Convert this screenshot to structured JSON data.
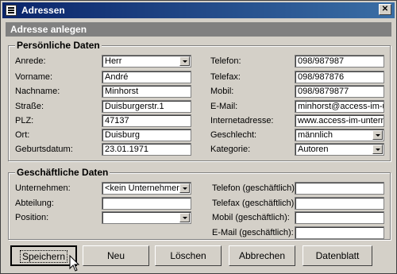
{
  "window": {
    "title": "Adressen",
    "close_label": "✕",
    "minimize_label": "_",
    "maximize_label": "□"
  },
  "header": {
    "title": "Adresse anlegen"
  },
  "personal": {
    "title": "Persönliche Daten",
    "anrede": {
      "label": "Anrede:",
      "value": "Herr"
    },
    "vorname": {
      "label": "Vorname:",
      "value": "André"
    },
    "nachname": {
      "label": "Nachname:",
      "value": "Minhorst"
    },
    "strasse": {
      "label": "Straße:",
      "value": "Duisburgerstr.1"
    },
    "plz": {
      "label": "PLZ:",
      "value": "47137"
    },
    "ort": {
      "label": "Ort:",
      "value": "Duisburg"
    },
    "geburtsdatum": {
      "label": "Geburtsdatum:",
      "value": "23.01.1971"
    },
    "telefon": {
      "label": "Telefon:",
      "value": "098/987987"
    },
    "telefax": {
      "label": "Telefax:",
      "value": "098/987876"
    },
    "mobil": {
      "label": "Mobil:",
      "value": "098/9879877"
    },
    "email": {
      "label": "E-Mail:",
      "value": "minhorst@access-im-un"
    },
    "internet": {
      "label": "Internetadresse:",
      "value": "www.access-im-unterne"
    },
    "geschlecht": {
      "label": "Geschlecht:",
      "value": "männlich"
    },
    "kategorie": {
      "label": "Kategorie:",
      "value": "Autoren"
    }
  },
  "business": {
    "title": "Geschäftliche Daten",
    "unternehmen": {
      "label": "Unternehmen:",
      "value": "<kein Unternehmen"
    },
    "abteilung": {
      "label": "Abteilung:",
      "value": ""
    },
    "position": {
      "label": "Position:",
      "value": ""
    },
    "telefon": {
      "label": "Telefon (geschäftlich):",
      "value": ""
    },
    "telefax": {
      "label": "Telefax (geschäftlich):",
      "value": ""
    },
    "mobil": {
      "label": "Mobil (geschäftlich):",
      "value": ""
    },
    "email": {
      "label": "E-Mail (geschäftlich):",
      "value": ""
    }
  },
  "buttons": {
    "speichern": "Speichern",
    "neu": "Neu",
    "loeschen": "Löschen",
    "abbrechen": "Abbrechen",
    "datenblatt": "Datenblatt"
  }
}
